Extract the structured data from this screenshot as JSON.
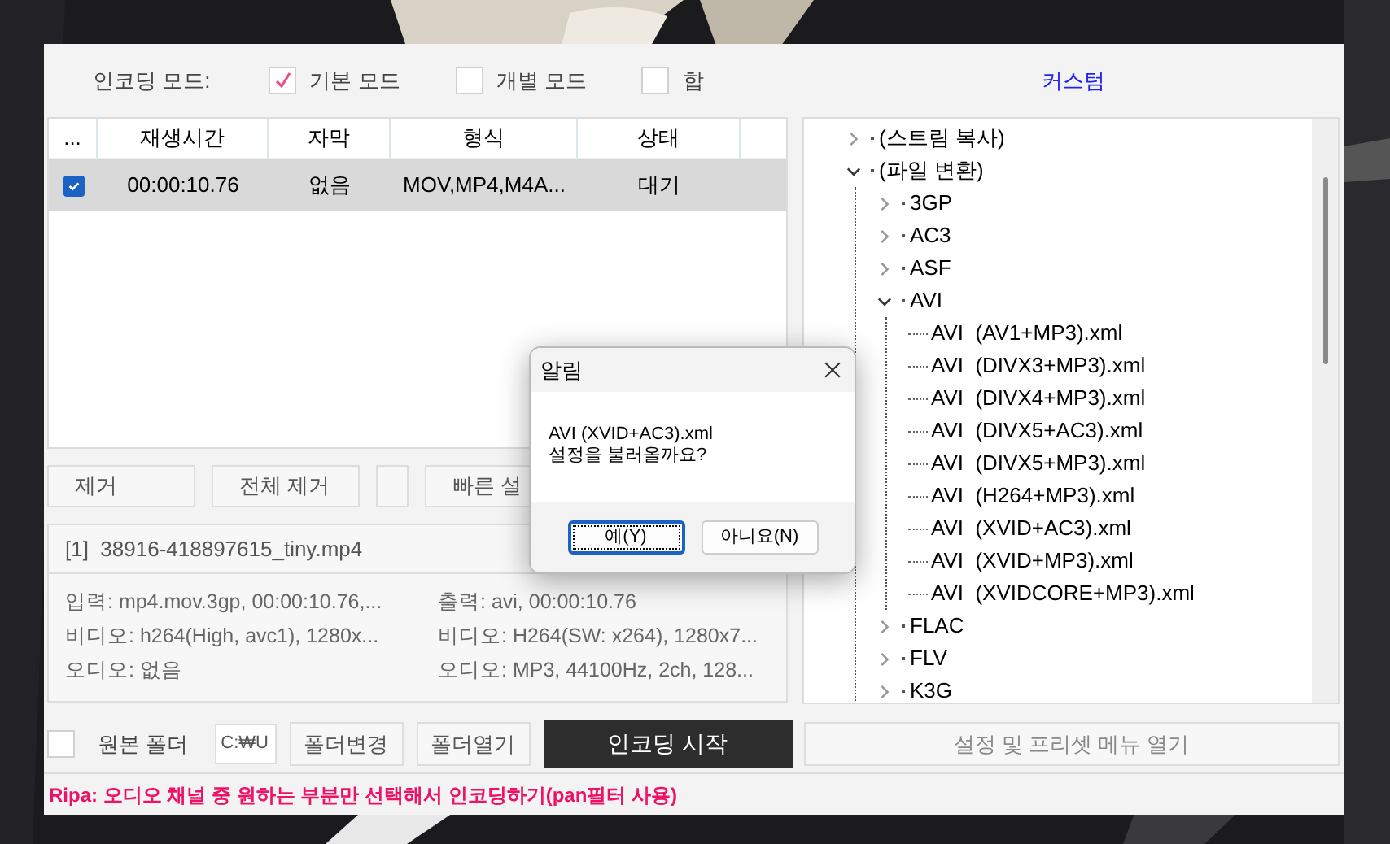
{
  "mode_bar": {
    "label": "인코딩 모드:",
    "options": [
      {
        "label": "기본 모드",
        "checked": true
      },
      {
        "label": "개별 모드",
        "checked": false
      },
      {
        "label": "합",
        "checked": false
      }
    ],
    "custom_link": "커스텀"
  },
  "table": {
    "check_header": "...",
    "columns": [
      "재생시간",
      "자막",
      "형식",
      "상태"
    ],
    "rows": [
      {
        "checked": true,
        "selected": true,
        "cells": [
          "00:00:10.76",
          "없음",
          "MOV,MP4,M4A...",
          "대기"
        ]
      }
    ]
  },
  "action_buttons": [
    {
      "kind": "text",
      "label": "제거"
    },
    {
      "kind": "text",
      "label": "전체 제거"
    },
    {
      "kind": "blank"
    },
    {
      "kind": "text",
      "label": "빠른 설"
    }
  ],
  "info": {
    "file": "[1]  38916-418897615_tiny.mp4",
    "input": [
      "입력: mp4.mov.3gp, 00:00:10.76,...",
      "비디오: h264(High, avc1), 1280x...",
      "오디오: 없음"
    ],
    "output": [
      "출력: avi, 00:00:10.76",
      "비디오: H264(SW: x264), 1280x7...",
      "오디오: MP3, 44100Hz, 2ch, 128..."
    ]
  },
  "tree": [
    {
      "label": "(스트림 복사)",
      "expanded": false
    },
    {
      "label": "(파일 변환)",
      "expanded": true,
      "children": [
        {
          "label": "3GP",
          "expanded": false
        },
        {
          "label": "AC3",
          "expanded": false
        },
        {
          "label": "ASF",
          "expanded": false
        },
        {
          "label": "AVI",
          "expanded": true,
          "children": [
            {
              "label": "AVI  (AV1+MP3).xml"
            },
            {
              "label": "AVI  (DIVX3+MP3).xml"
            },
            {
              "label": "AVI  (DIVX4+MP3).xml"
            },
            {
              "label": "AVI  (DIVX5+AC3).xml"
            },
            {
              "label": "AVI  (DIVX5+MP3).xml"
            },
            {
              "label": "AVI  (H264+MP3).xml"
            },
            {
              "label": "AVI  (XVID+AC3).xml"
            },
            {
              "label": "AVI  (XVID+MP3).xml"
            },
            {
              "label": "AVI  (XVIDCORE+MP3).xml"
            }
          ]
        },
        {
          "label": "FLAC",
          "expanded": false
        },
        {
          "label": "FLV",
          "expanded": false
        },
        {
          "label": "K3G",
          "expanded": false
        }
      ]
    }
  ],
  "bottom_bar": {
    "source_folder": {
      "label": "원본 폴더",
      "checked": false
    },
    "path": "C:₩U",
    "buttons": [
      "폴더변경",
      "폴더열기"
    ],
    "start": "인코딩 시작",
    "menu": "설정 및 프리셋 메뉴 열기"
  },
  "tip": "Ripa: 오디오 채널 중 원하는 부분만 선택해서 인코딩하기(pan필터 사용)",
  "dialog": {
    "title": "알림",
    "message": [
      "AVI (XVID+AC3).xml",
      "설정을 불러올까요?"
    ],
    "buttons": [
      {
        "label": "예(Y)",
        "selected": true
      },
      {
        "label": "아니요(N)",
        "selected": false
      }
    ]
  }
}
